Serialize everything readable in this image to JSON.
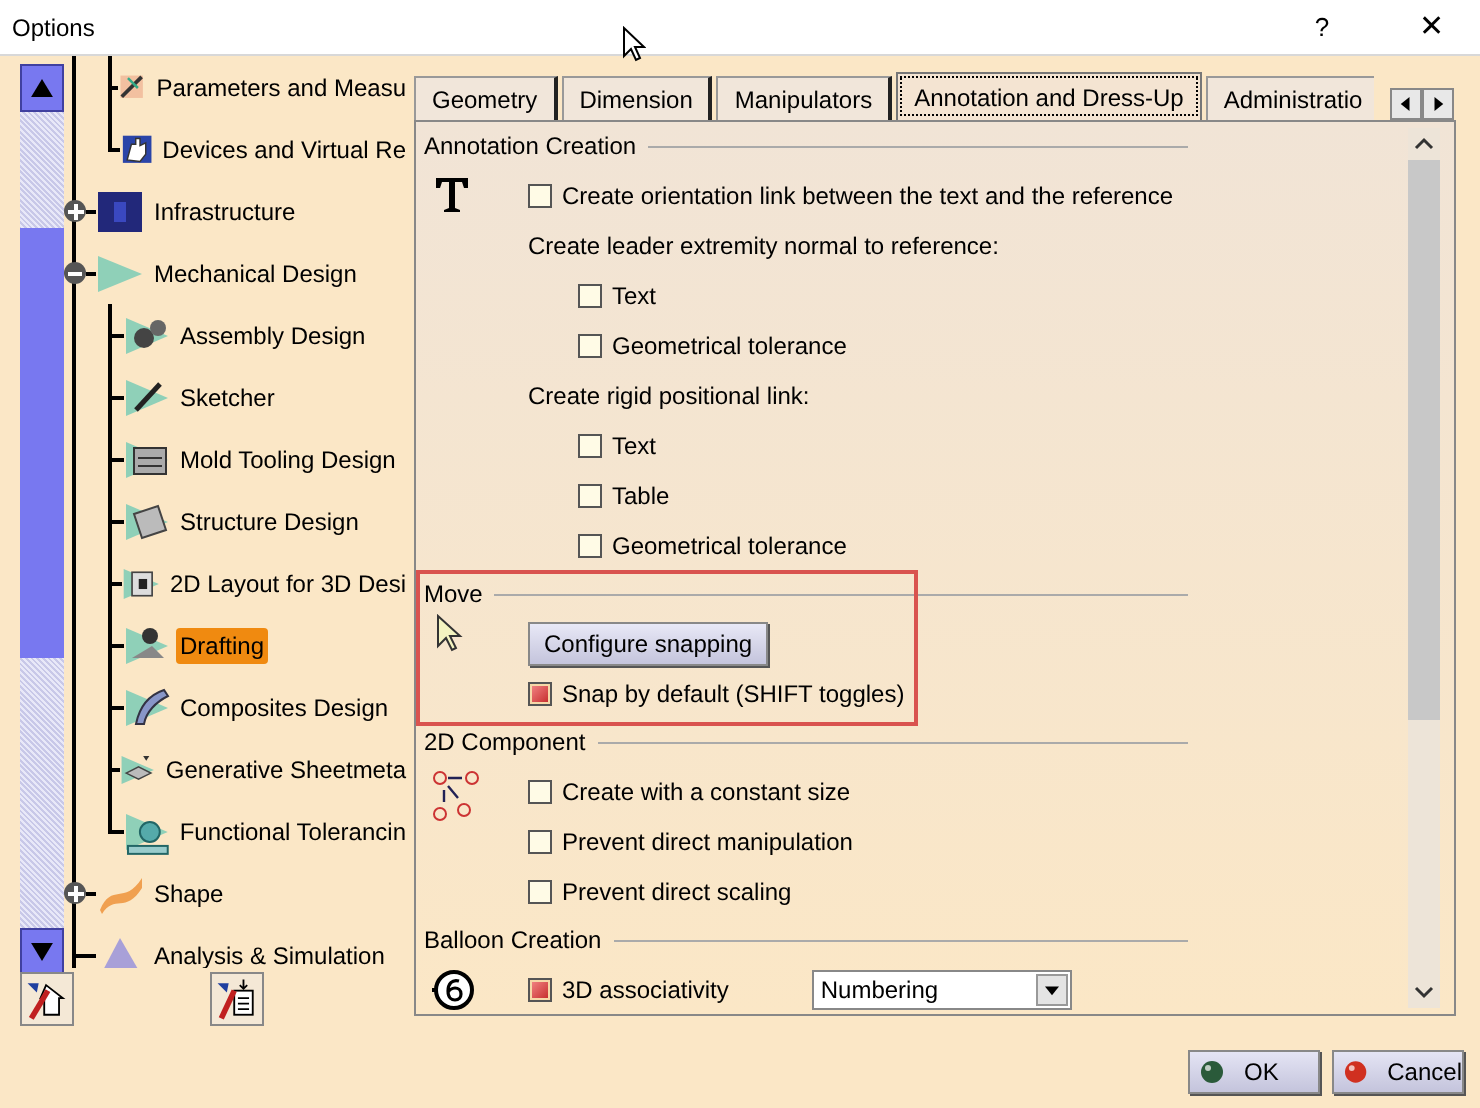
{
  "window": {
    "title": "Options",
    "help": "?",
    "close": "✕"
  },
  "tree_continued": [
    {
      "label": "Parameters and Measu",
      "selected": false
    },
    {
      "label": "Devices and Virtual Re",
      "selected": false
    }
  ],
  "tree": [
    {
      "label": "Infrastructure",
      "expanded": false,
      "selected": false
    },
    {
      "label": "Mechanical Design",
      "expanded": true,
      "selected": false,
      "children": [
        {
          "label": "Assembly Design",
          "selected": false
        },
        {
          "label": "Sketcher",
          "selected": false
        },
        {
          "label": "Mold Tooling Design",
          "selected": false
        },
        {
          "label": "Structure Design",
          "selected": false
        },
        {
          "label": "2D Layout for 3D Desi",
          "selected": false
        },
        {
          "label": "Drafting",
          "selected": true
        },
        {
          "label": "Composites Design",
          "selected": false
        },
        {
          "label": "Generative Sheetmeta",
          "selected": false
        },
        {
          "label": "Functional Tolerancin",
          "selected": false
        }
      ]
    },
    {
      "label": "Shape",
      "expanded": false,
      "selected": false
    },
    {
      "label": "Analysis & Simulation",
      "selected": false
    }
  ],
  "tabs": [
    {
      "label": "Geometry",
      "selected": false
    },
    {
      "label": "Dimension",
      "selected": false
    },
    {
      "label": "Manipulators",
      "selected": false
    },
    {
      "label": "Annotation and Dress-Up",
      "selected": true
    },
    {
      "label": "Administratio",
      "selected": false
    }
  ],
  "sections": [
    {
      "title": "Annotation Creation",
      "items": [
        {
          "kind": "checkbox",
          "label": "Create orientation link between the text and the reference",
          "checked": false
        },
        {
          "kind": "label",
          "label": "Create leader extremity normal to reference:",
          "children": [
            {
              "kind": "checkbox",
              "label": "Text",
              "checked": false
            },
            {
              "kind": "checkbox",
              "label": "Geometrical tolerance",
              "checked": false
            }
          ]
        },
        {
          "kind": "label",
          "label": "Create rigid positional link:",
          "children": [
            {
              "kind": "checkbox",
              "label": "Text",
              "checked": false
            },
            {
              "kind": "checkbox",
              "label": "Table",
              "checked": false
            },
            {
              "kind": "checkbox",
              "label": "Geometrical tolerance",
              "checked": false
            }
          ]
        }
      ]
    },
    {
      "title": "Move",
      "highlighted": true,
      "items": [
        {
          "kind": "button",
          "label": "Configure snapping"
        },
        {
          "kind": "checkbox",
          "label": "Snap by default (SHIFT toggles)",
          "checked": true
        }
      ]
    },
    {
      "title": "2D Component",
      "items": [
        {
          "kind": "checkbox",
          "label": "Create with a constant size",
          "checked": false
        },
        {
          "kind": "checkbox",
          "label": "Prevent direct manipulation",
          "checked": false
        },
        {
          "kind": "checkbox",
          "label": "Prevent direct scaling",
          "checked": false
        }
      ]
    },
    {
      "title": "Balloon Creation",
      "items": [
        {
          "kind": "checkbox_dropdown",
          "label": "3D associativity",
          "checked": true,
          "value": "Numbering"
        }
      ]
    }
  ],
  "buttons": [
    {
      "kind": "ok",
      "label": "OK"
    },
    {
      "kind": "cancel",
      "label": "Cancel"
    }
  ]
}
